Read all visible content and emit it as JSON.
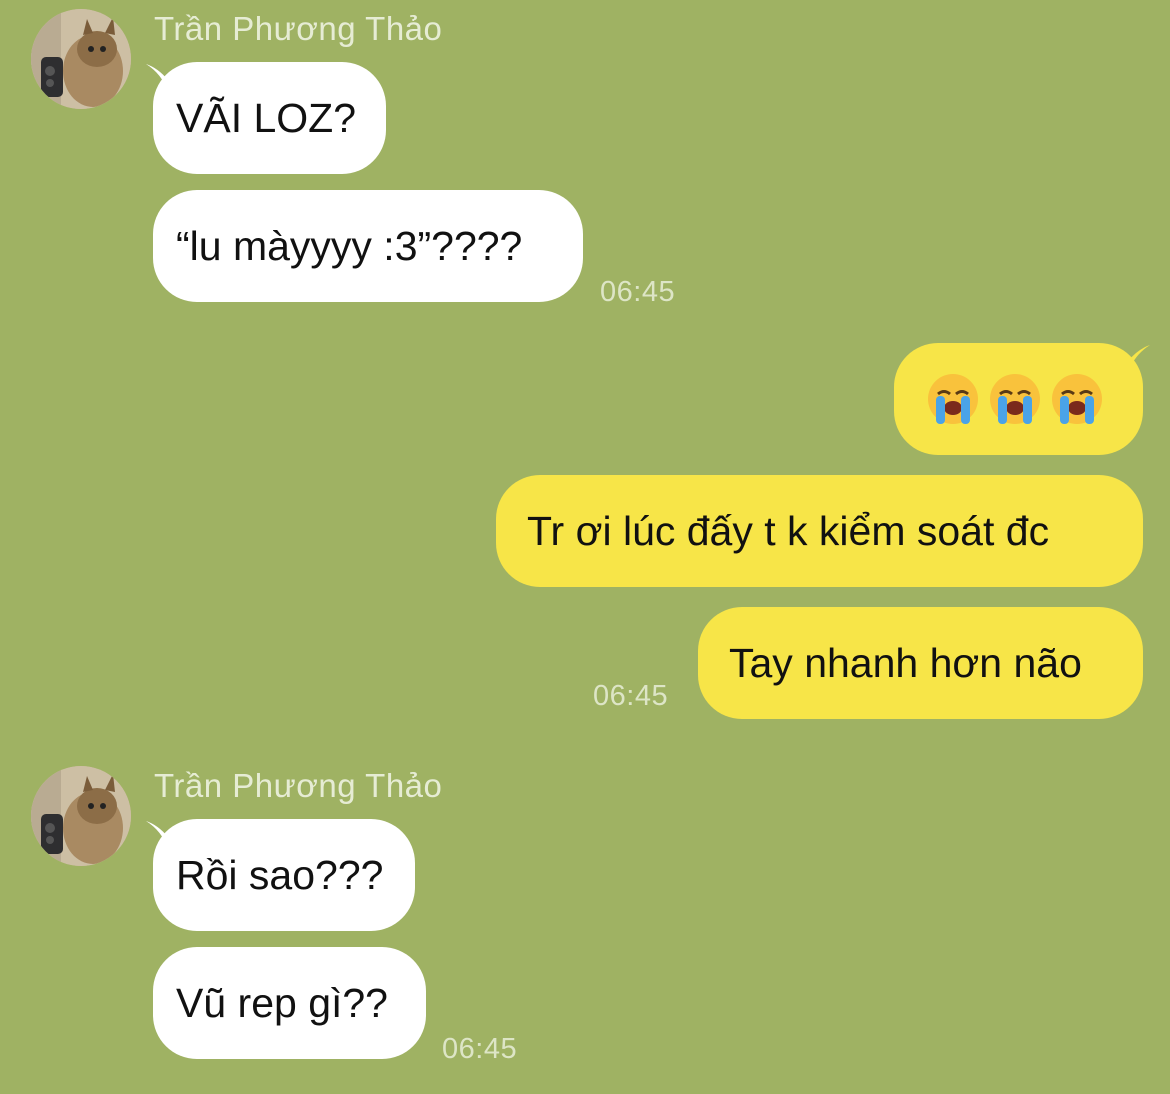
{
  "colors": {
    "background": "#9fb263",
    "incoming_bubble": "#ffffff",
    "outgoing_bubble": "#f7e548",
    "meta_text": "#e6ecd4"
  },
  "groups": [
    {
      "sender": "Trần Phương Thảo",
      "avatar_icon": "cat-photo-avatar",
      "messages": [
        "VÃI LOZ?",
        "“lu màyyyy :3”????"
      ],
      "time": "06:45"
    },
    {
      "sender": "me",
      "messages": [
        "😭😭😭",
        "Tr ơi lúc đấy t k kiểm soát đc",
        "Tay nhanh hơn não"
      ],
      "emoji_icons": [
        "loudly-crying-face-icon",
        "loudly-crying-face-icon",
        "loudly-crying-face-icon"
      ],
      "time": "06:45"
    },
    {
      "sender": "Trần Phương Thảo",
      "avatar_icon": "cat-photo-avatar",
      "messages": [
        "Rồi sao???",
        "Vũ rep gì??"
      ],
      "time": "06:45"
    }
  ]
}
